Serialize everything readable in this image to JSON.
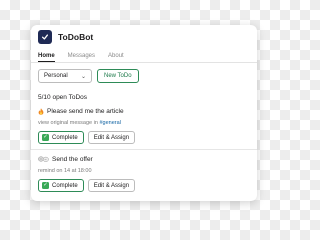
{
  "app": {
    "name": "ToDoBot",
    "icon": "checkmark-icon"
  },
  "tabs": [
    {
      "label": "Home",
      "active": true
    },
    {
      "label": "Messages",
      "active": false
    },
    {
      "label": "About",
      "active": false
    }
  ],
  "controls": {
    "filter_value": "Personal",
    "new_button_label": "New ToDo"
  },
  "summary": "5/10 open ToDos",
  "items": [
    {
      "icon": "fire-icon",
      "title": "Please send me the article",
      "subtitle_prefix": "view original message in ",
      "subtitle_link": "#general",
      "complete_label": "Complete",
      "edit_label": "Edit & Assign"
    },
    {
      "icon": "speech-bubbles-icon",
      "title": "Send the offer",
      "subtitle_prefix": "remind on 14 at 18:00",
      "subtitle_link": "",
      "complete_label": "Complete",
      "edit_label": "Edit & Assign"
    }
  ],
  "colors": {
    "accent_green": "#2e8b57",
    "link_blue": "#1264a3",
    "app_icon_bg": "#1f2a55"
  }
}
